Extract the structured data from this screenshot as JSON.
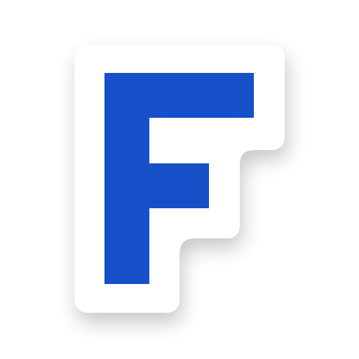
{
  "icon": {
    "name": "letter-f-logo-icon",
    "letter": "F",
    "colors": {
      "background": "#ffffff",
      "sticker": "#ffffff",
      "letter": "#1550C8",
      "shadow": "#000000"
    }
  }
}
